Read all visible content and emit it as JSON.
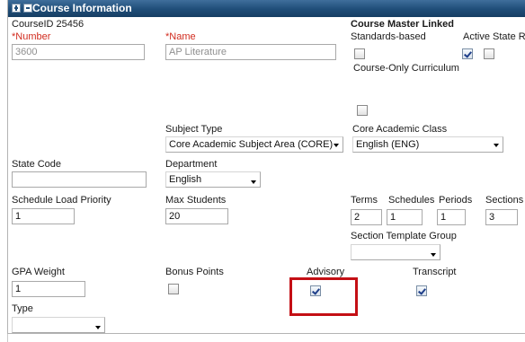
{
  "panel": {
    "title": "Course Information"
  },
  "course_id_label": "CourseID 25456",
  "course_master_label": "Course Master Linked",
  "number": {
    "label": "*Number",
    "value": "3600"
  },
  "name": {
    "label": "*Name",
    "value": "AP Literature"
  },
  "standards_based": {
    "label": "Standards-based",
    "checked": false
  },
  "active_state": {
    "label": "Active State R",
    "checked": true
  },
  "course_only_curriculum": {
    "label": "Course-Only Curriculum",
    "checked": false
  },
  "subject_type": {
    "label": "Subject Type",
    "value": "Core Academic Subject Area (CORE)"
  },
  "core_academic_class": {
    "label": "Core Academic Class",
    "value": "English (ENG)"
  },
  "state_code": {
    "label": "State Code",
    "value": ""
  },
  "department": {
    "label": "Department",
    "value": "English"
  },
  "schedule_load_priority": {
    "label": "Schedule Load Priority",
    "value": "1"
  },
  "max_students": {
    "label": "Max Students",
    "value": "20"
  },
  "terms": {
    "label": "Terms",
    "value": "2"
  },
  "schedules": {
    "label": "Schedules",
    "value": "1"
  },
  "periods": {
    "label": "Periods",
    "value": "1"
  },
  "sections": {
    "label": "Sections",
    "value": "3"
  },
  "section_template_group": {
    "label": "Section Template Group",
    "value": ""
  },
  "gpa_weight": {
    "label": "GPA Weight",
    "value": "1"
  },
  "bonus_points": {
    "label": "Bonus Points",
    "checked": false
  },
  "advisory": {
    "label": "Advisory",
    "checked": true
  },
  "transcript": {
    "label": "Transcript",
    "checked": true
  },
  "type": {
    "label": "Type",
    "value": ""
  },
  "colors": {
    "header": "#1f4d78",
    "required": "#d12b1e",
    "highlight": "#c40f15"
  }
}
